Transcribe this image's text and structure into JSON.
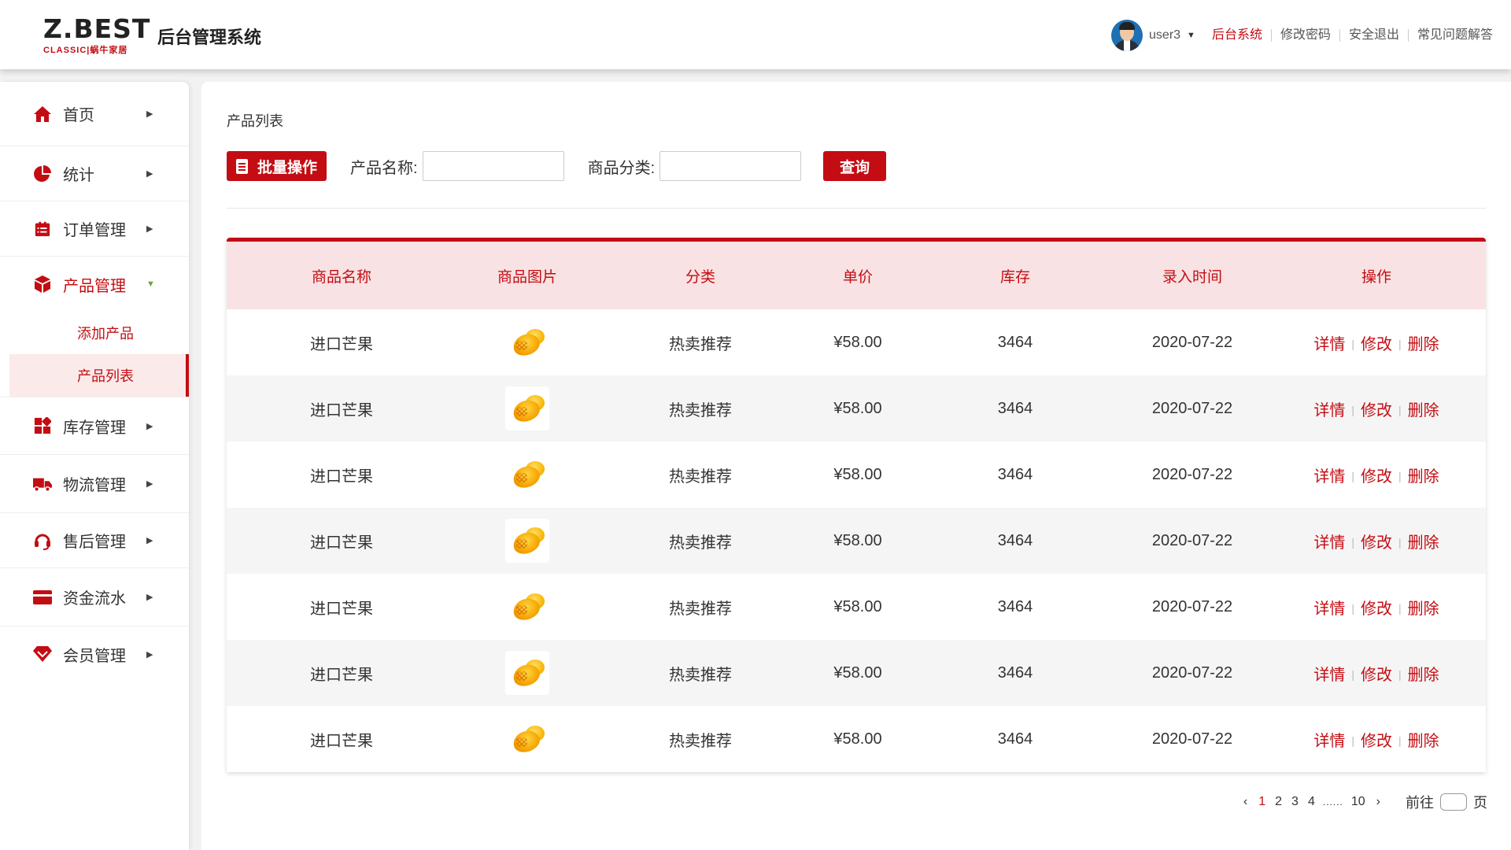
{
  "header": {
    "logo_main": "Z.BEST",
    "logo_sub": "CLASSIC|蜗牛家居",
    "title": "后台管理系统",
    "username": "user3",
    "links": [
      "后台系统",
      "修改密码",
      "安全退出",
      "常见问题解答"
    ]
  },
  "sidebar": {
    "items": [
      {
        "label": "首页",
        "icon": "home-icon"
      },
      {
        "label": "统计",
        "icon": "pie-chart-icon"
      },
      {
        "label": "订单管理",
        "icon": "order-icon"
      },
      {
        "label": "产品管理",
        "icon": "cube-icon"
      },
      {
        "label": "库存管理",
        "icon": "grid-icon"
      },
      {
        "label": "物流管理",
        "icon": "truck-icon"
      },
      {
        "label": "售后管理",
        "icon": "headset-icon"
      },
      {
        "label": "资金流水",
        "icon": "card-icon"
      },
      {
        "label": "会员管理",
        "icon": "gem-icon"
      }
    ],
    "sub_items": [
      "添加产品",
      "产品列表"
    ]
  },
  "main": {
    "breadcrumb": "产品列表",
    "batch_button": "批量操作",
    "name_label": "产品名称:",
    "category_label": "商品分类:",
    "query_button": "查询",
    "columns": [
      "商品名称",
      "商品图片",
      "分类",
      "单价",
      "库存",
      "录入时间",
      "操作"
    ],
    "rows": [
      {
        "name": "进口芒果",
        "category": "热卖推荐",
        "price": "¥58.00",
        "stock": "3464",
        "date": "2020-07-22"
      },
      {
        "name": "进口芒果",
        "category": "热卖推荐",
        "price": "¥58.00",
        "stock": "3464",
        "date": "2020-07-22"
      },
      {
        "name": "进口芒果",
        "category": "热卖推荐",
        "price": "¥58.00",
        "stock": "3464",
        "date": "2020-07-22"
      },
      {
        "name": "进口芒果",
        "category": "热卖推荐",
        "price": "¥58.00",
        "stock": "3464",
        "date": "2020-07-22"
      },
      {
        "name": "进口芒果",
        "category": "热卖推荐",
        "price": "¥58.00",
        "stock": "3464",
        "date": "2020-07-22"
      },
      {
        "name": "进口芒果",
        "category": "热卖推荐",
        "price": "¥58.00",
        "stock": "3464",
        "date": "2020-07-22"
      },
      {
        "name": "进口芒果",
        "category": "热卖推荐",
        "price": "¥58.00",
        "stock": "3464",
        "date": "2020-07-22"
      }
    ],
    "actions": [
      "详情",
      "修改",
      "删除"
    ]
  },
  "pager": {
    "pages": [
      "1",
      "2",
      "3",
      "4"
    ],
    "dots": "......",
    "last": "10",
    "goto_label": "前往",
    "goto_suffix": "页"
  },
  "colors": {
    "accent": "#c30d13",
    "header_row": "#f9e2e3"
  }
}
